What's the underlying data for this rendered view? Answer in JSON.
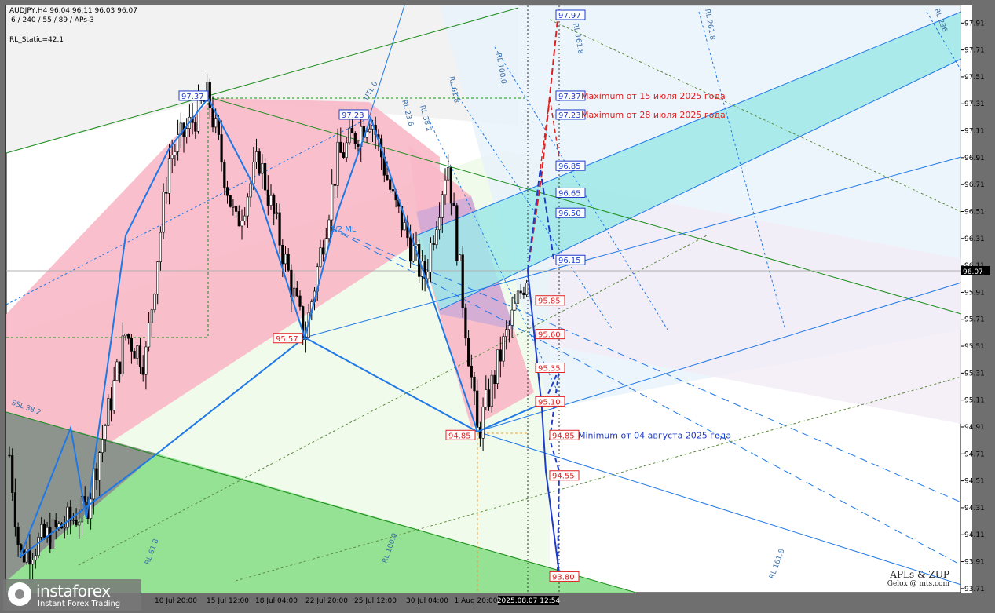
{
  "header": {
    "line1": "AUDJPY,H4  96.04 96.11 96.03 96.07",
    "line2": "6 / 240 / 55 / 89 / APs-3",
    "indicator": "RL_Static=42.1"
  },
  "watermark": {
    "name": "instaforex",
    "sub": "Instant Forex Trading"
  },
  "signature": {
    "line1": "APLs & ZUP",
    "line2": "Gelox @ mts.com"
  },
  "annotations": {
    "max_jul15": "Maximum от 15 июля 2025 года",
    "max_jul28": "Maximum от 28 июля 2025 года",
    "min_aug04": "Minimum от 04 августа 2025 года",
    "ml_label": "1/2 ML"
  },
  "chart_data": {
    "type": "candlestick",
    "symbol": "AUDJPY",
    "timeframe": "H4",
    "ylim": [
      93.71,
      97.99
    ],
    "y_ticks": [
      97.91,
      97.71,
      97.51,
      97.31,
      97.11,
      96.91,
      96.71,
      96.51,
      96.31,
      96.11,
      95.91,
      95.71,
      95.51,
      95.31,
      95.11,
      94.91,
      94.71,
      94.51,
      94.31,
      94.11,
      93.91,
      93.71
    ],
    "x_ticks": [
      "10 Jul 20:00",
      "15 Jul 12:00",
      "18 Jul 04:00",
      "22 Jul 20:00",
      "25 Jul 12:00",
      "30 Jul 04:00",
      "1 Aug 20:00"
    ],
    "x_current": "2025.08.07 12:54",
    "current_price": 96.07,
    "ohlc_last": {
      "open": 96.04,
      "high": 96.11,
      "low": 96.03,
      "close": 96.07
    },
    "zigzag_points": [
      {
        "label": "97.37",
        "value": 97.37
      },
      {
        "label": "97.23",
        "value": 97.23
      },
      {
        "label": "95.57",
        "value": 95.57
      },
      {
        "label": "94.85",
        "value": 94.85
      }
    ],
    "forecast_levels_blue": [
      {
        "label": "97.97",
        "value": 97.97
      },
      {
        "label": "97.37",
        "value": 97.37
      },
      {
        "label": "97.23",
        "value": 97.23
      },
      {
        "label": "96.85",
        "value": 96.85
      },
      {
        "label": "96.65",
        "value": 96.65
      },
      {
        "label": "96.50",
        "value": 96.5
      },
      {
        "label": "96.15",
        "value": 96.15
      }
    ],
    "forecast_levels_red": [
      {
        "label": "95.85",
        "value": 95.85
      },
      {
        "label": "95.60",
        "value": 95.6
      },
      {
        "label": "95.35",
        "value": 95.35
      },
      {
        "label": "95.10",
        "value": 95.1
      },
      {
        "label": "94.85",
        "value": 94.85
      },
      {
        "label": "94.55",
        "value": 94.55
      },
      {
        "label": "93.80",
        "value": 93.8
      }
    ],
    "channel_labels": [
      "RL 100.0",
      "RL 61.8",
      "RL 23.6",
      "RL 38.2",
      "UTL 0",
      "RL 161.8",
      "RL 261.8",
      "RL 236",
      "SSL 38.2",
      "RL 61.8",
      "RL 100.0",
      "RL 161.8"
    ],
    "colors": {
      "bull": "#000000",
      "bear": "#000000",
      "pink_zone": "#f8b8c8",
      "green_zone": "#90e090",
      "cyan_zone": "#9ee8e8",
      "blue_line": "#1e78e6",
      "red_line": "#e02020",
      "purple_zone": "#b8a0e0"
    }
  }
}
